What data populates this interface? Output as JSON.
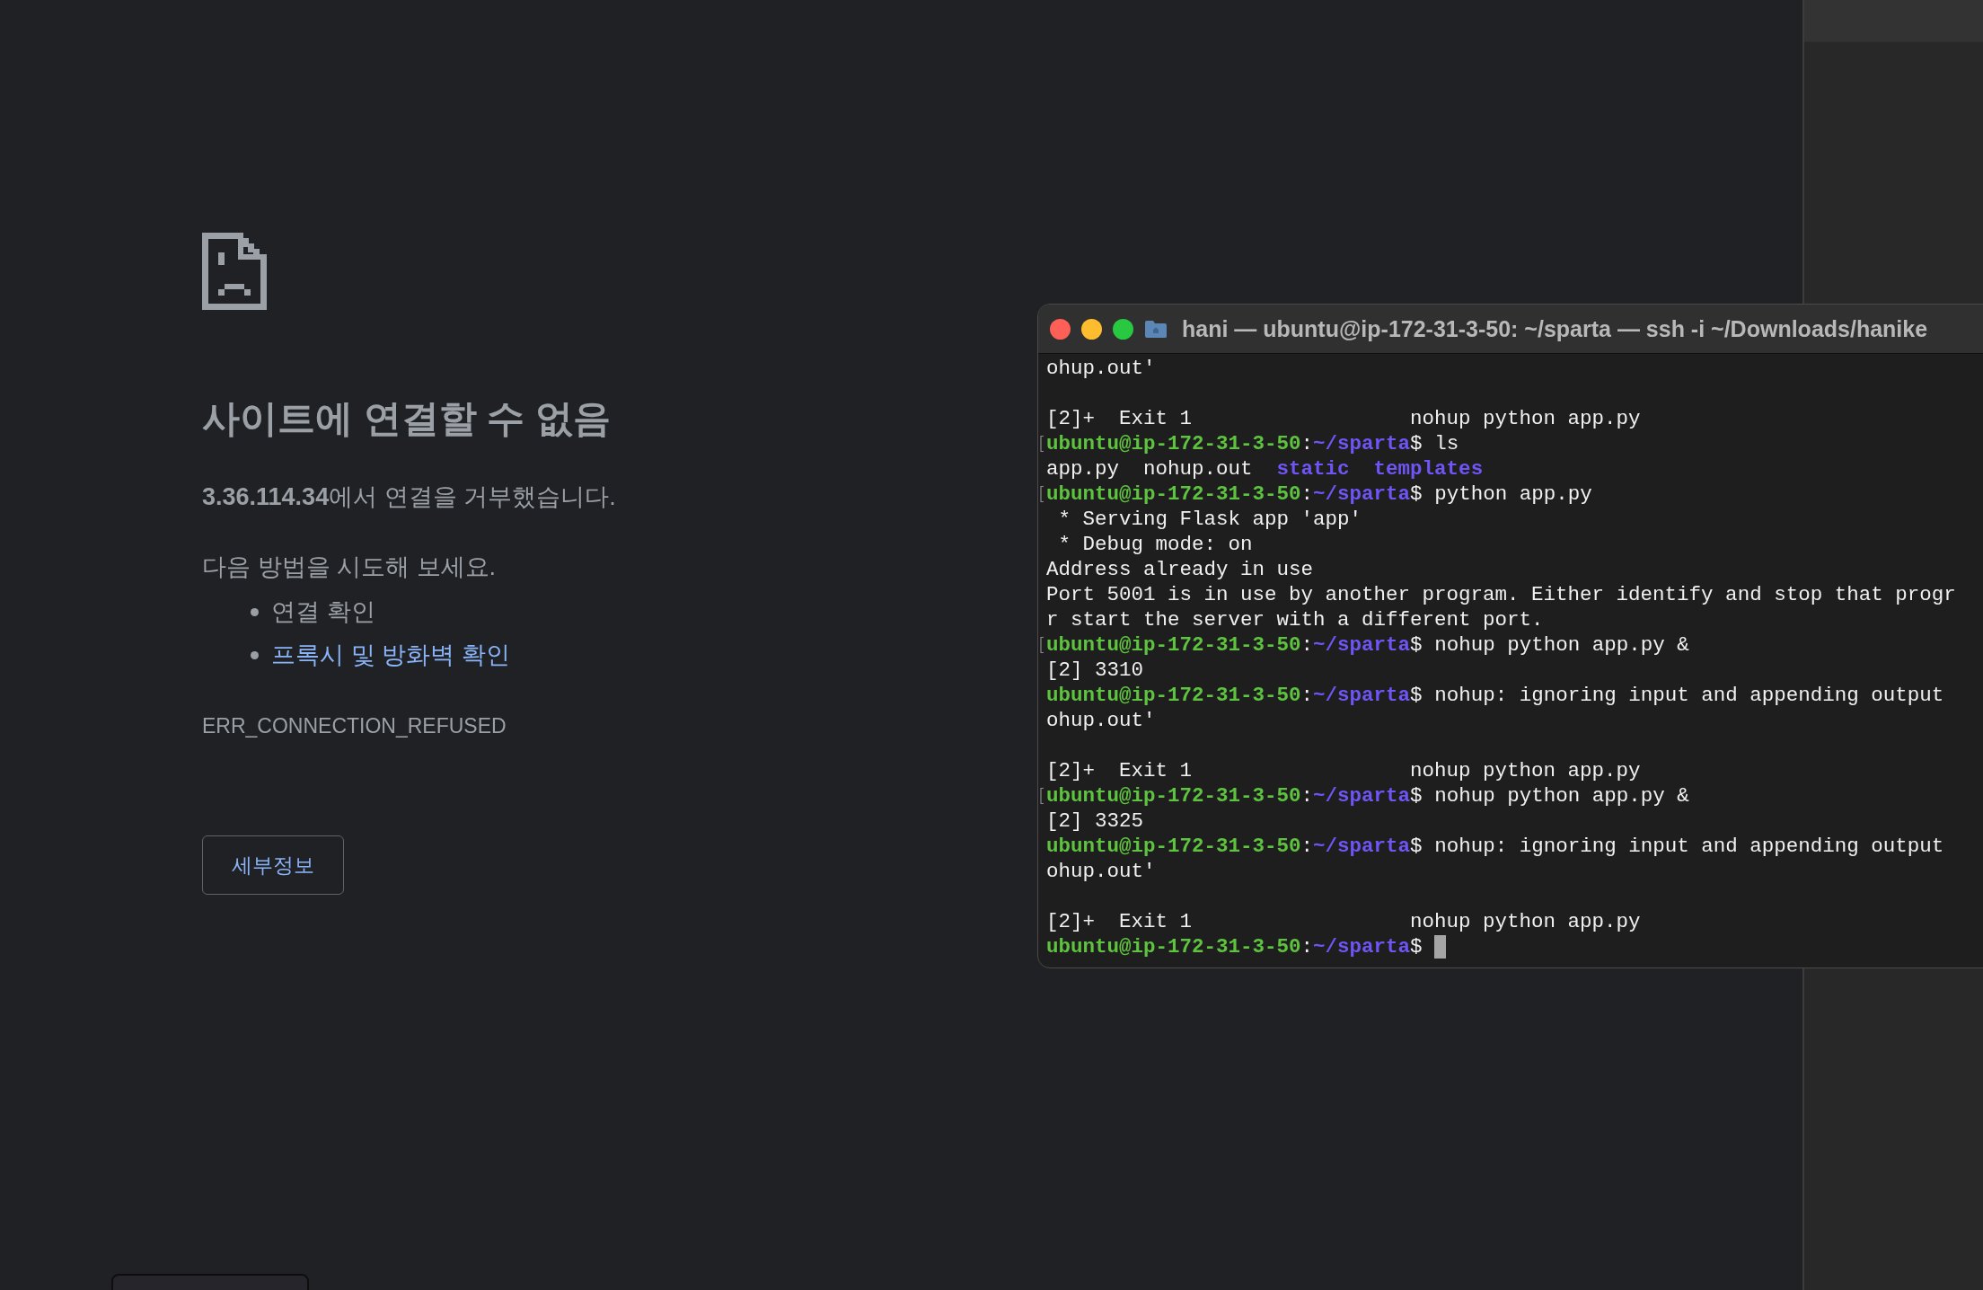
{
  "browser_error": {
    "title": "사이트에 연결할 수 없음",
    "message": "**3.36.114.34**에서 연결을 거부했습니다.",
    "suggestion_heading": "다음 방법을 시도해 보세요.",
    "suggestions": [
      {
        "text": "연결 확인",
        "kind": "text"
      },
      {
        "text": "프록시 및 방화벽 확인",
        "kind": "link"
      }
    ],
    "error_code": "ERR_CONNECTION_REFUSED",
    "details_button": "세부정보"
  },
  "terminal": {
    "title": "hani — ubuntu@ip-172-31-3-50: ~/sparta — ssh -i ~/Downloads/hanike",
    "lines": [
      {
        "kind": "output",
        "text": "ohup.out'"
      },
      {
        "kind": "blank"
      },
      {
        "kind": "output",
        "text": "[2]+  Exit 1                  nohup python app.py"
      },
      {
        "kind": "prompt",
        "marked": true,
        "cursor": false,
        "user": "ubuntu@ip-172-31-3-50",
        "sep": ":",
        "path": "~/sparta",
        "symbol": "$",
        "command": "ls"
      },
      {
        "kind": "listing",
        "items": [
          {
            "text": "app.py",
            "dir": false
          },
          {
            "text": "nohup.out",
            "dir": false
          },
          {
            "text": "static",
            "dir": true
          },
          {
            "text": "templates",
            "dir": true
          }
        ]
      },
      {
        "kind": "prompt",
        "marked": true,
        "cursor": false,
        "user": "ubuntu@ip-172-31-3-50",
        "sep": ":",
        "path": "~/sparta",
        "symbol": "$",
        "command": "python app.py"
      },
      {
        "kind": "output",
        "text": " * Serving Flask app 'app'"
      },
      {
        "kind": "output",
        "text": " * Debug mode: on"
      },
      {
        "kind": "output",
        "text": "Address already in use"
      },
      {
        "kind": "output",
        "text": "Port 5001 is in use by another program. Either identify and stop that progr"
      },
      {
        "kind": "output",
        "text": "r start the server with a different port."
      },
      {
        "kind": "prompt",
        "marked": true,
        "cursor": false,
        "user": "ubuntu@ip-172-31-3-50",
        "sep": ":",
        "path": "~/sparta",
        "symbol": "$",
        "command": "nohup python app.py &"
      },
      {
        "kind": "output",
        "text": "[2] 3310"
      },
      {
        "kind": "prompt",
        "marked": false,
        "cursor": false,
        "user": "ubuntu@ip-172-31-3-50",
        "sep": ":",
        "path": "~/sparta",
        "symbol": "$",
        "command": "nohup: ignoring input and appending output"
      },
      {
        "kind": "output",
        "text": "ohup.out'"
      },
      {
        "kind": "blank"
      },
      {
        "kind": "output",
        "text": "[2]+  Exit 1                  nohup python app.py"
      },
      {
        "kind": "prompt",
        "marked": true,
        "cursor": false,
        "user": "ubuntu@ip-172-31-3-50",
        "sep": ":",
        "path": "~/sparta",
        "symbol": "$",
        "command": "nohup python app.py &"
      },
      {
        "kind": "output",
        "text": "[2] 3325"
      },
      {
        "kind": "prompt",
        "marked": false,
        "cursor": false,
        "user": "ubuntu@ip-172-31-3-50",
        "sep": ":",
        "path": "~/sparta",
        "symbol": "$",
        "command": "nohup: ignoring input and appending output"
      },
      {
        "kind": "output",
        "text": "ohup.out'"
      },
      {
        "kind": "blank"
      },
      {
        "kind": "output",
        "text": "[2]+  Exit 1                  nohup python app.py"
      },
      {
        "kind": "prompt",
        "marked": false,
        "cursor": true,
        "user": "ubuntu@ip-172-31-3-50",
        "sep": ":",
        "path": "~/sparta",
        "symbol": "$"
      }
    ]
  }
}
